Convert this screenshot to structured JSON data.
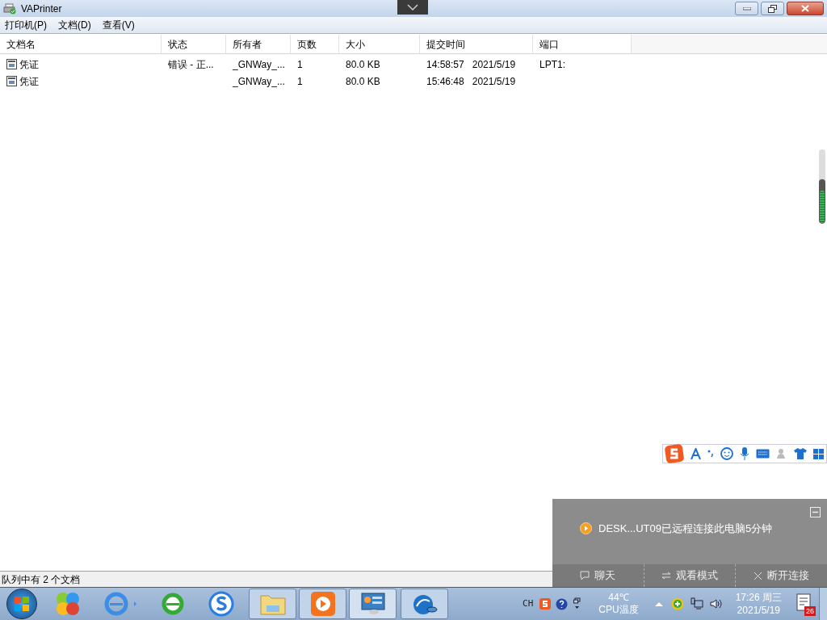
{
  "window": {
    "title": "VAPrinter"
  },
  "menu": [
    "打印机(P)",
    "文档(D)",
    "查看(V)"
  ],
  "table": {
    "columns": [
      "文档名",
      "状态",
      "所有者",
      "页数",
      "大小",
      "提交时间",
      "端口"
    ],
    "rows": [
      {
        "name": "凭证",
        "status": "错误 - 正...",
        "owner": "_GNWay_...",
        "pages": "1",
        "size": "80.0 KB",
        "submitted": "14:58:57   2021/5/19",
        "port": "LPT1:"
      },
      {
        "name": "凭证",
        "owner": "_GNWay_...",
        "pages": "1",
        "size": "80.0 KB",
        "submitted": "15:46:48   2021/5/19"
      }
    ]
  },
  "status_bar": "队列中有 2 个文档",
  "notification": {
    "message": "DESK...UT09已远程连接此电脑5分钟",
    "actions": [
      {
        "kind": "chat",
        "label": "聊天"
      },
      {
        "kind": "switch",
        "label": "观看模式"
      },
      {
        "kind": "close",
        "label": "断开连接"
      }
    ]
  },
  "tray": {
    "language": "CH",
    "temperature": "44℃",
    "temperature_label": "CPU温度",
    "time": "17:26 周三",
    "date": "2021/5/19",
    "badge": "26"
  }
}
